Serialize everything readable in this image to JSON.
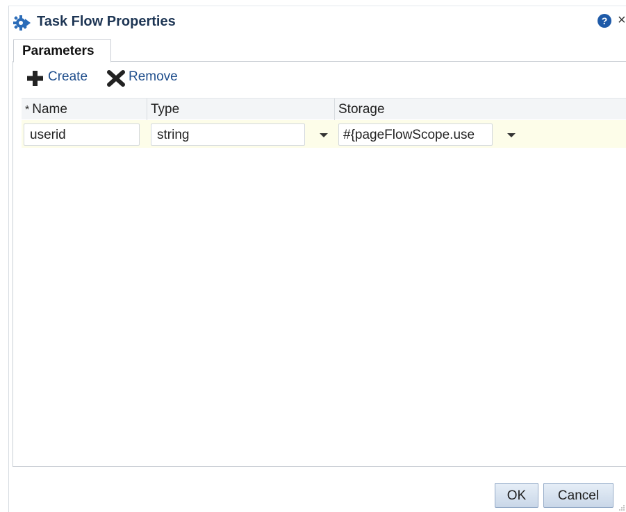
{
  "dialog": {
    "title": "Task Flow Properties",
    "help_icon": "?",
    "close_icon": "×"
  },
  "tabs": [
    {
      "label": "Parameters",
      "active": true
    }
  ],
  "toolbar": {
    "create_label": "Create",
    "remove_label": "Remove"
  },
  "table": {
    "columns": [
      {
        "label": "Name",
        "required_marker": "*"
      },
      {
        "label": "Type"
      },
      {
        "label": "Storage"
      }
    ],
    "rows": [
      {
        "name": "userid",
        "type": "string",
        "storage": "#{pageFlowScope.use"
      }
    ]
  },
  "footer": {
    "ok_label": "OK",
    "cancel_label": "Cancel"
  },
  "colors": {
    "title": "#1d3554",
    "link": "#1f4e8c",
    "row_highlight": "#fdfde9",
    "help_icon": "#1e5aa8"
  }
}
